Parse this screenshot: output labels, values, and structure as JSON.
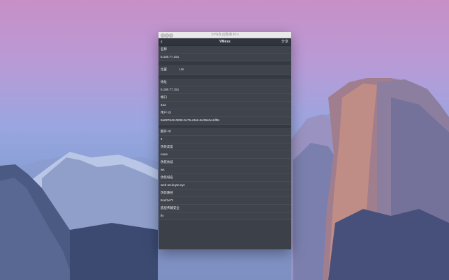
{
  "window": {
    "title": "VPN永远整菜 Pro",
    "nav_title": "VMess",
    "back_icon": "chevron-left-icon",
    "share_label": "分享"
  },
  "fields": {
    "name_label": "名称",
    "name_value": "5.180.77.151",
    "location_label": "位置",
    "location_value": "US",
    "address_label": "地址",
    "address_value": "5.180.77.151",
    "port_label": "端口",
    "port_value": "443",
    "userid_label": "用户 ID",
    "userid_value": "8a087648-0838-0e79-e3e6-8e39e0e4df8c",
    "extraid_label": "额外 ID",
    "extraid_value": "4",
    "camouflage_type_label": "伪装类型",
    "camouflage_type_value": "none",
    "camouflage_proto_label": "伪装协议",
    "camouflage_proto_value": "ws",
    "camouflage_domain_label": "伪装域名",
    "camouflage_domain_value": "web-16.kuyte.xyz",
    "camouflage_path_label": "伪装路径",
    "camouflage_path_value": "8cef1e71",
    "transport_label": "底层传输安全",
    "transport_value": "tls"
  },
  "colors": {
    "window_bg": "#3b4049",
    "navbar_bg": "#30343c",
    "text": "#f0f0f0"
  }
}
